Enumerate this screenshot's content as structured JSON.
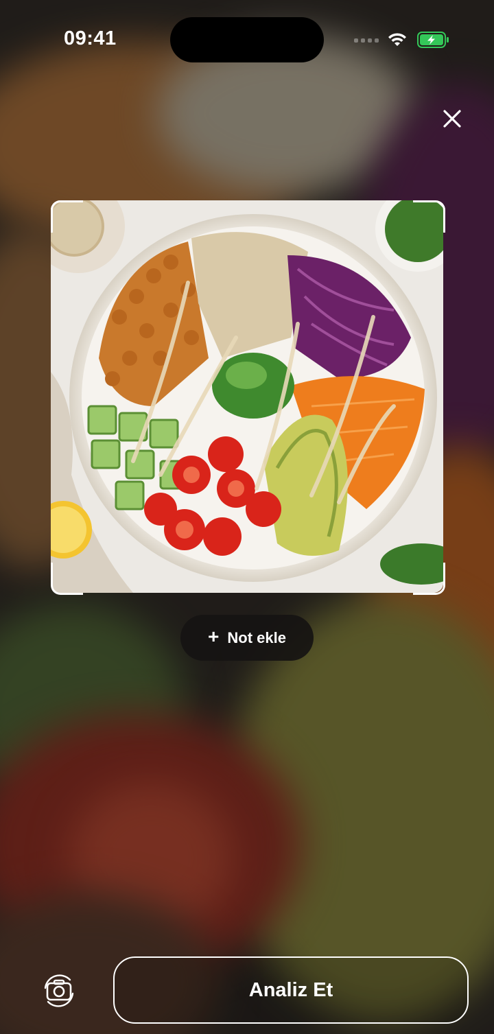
{
  "status_bar": {
    "time": "09:41",
    "icons": [
      "cellular-signal-icon",
      "wifi-icon",
      "battery-charging-icon"
    ],
    "battery_color": "#34c759"
  },
  "top_bar": {
    "close_icon": "close-icon"
  },
  "preview": {
    "photo": "captured-food-photo",
    "frame": "scan-frame-corners"
  },
  "note_button": {
    "icon": "plus-icon",
    "label": "Not ekle"
  },
  "bottom_bar": {
    "flip_icon": "camera-flip-icon",
    "analyze_label": "Analiz Et"
  }
}
